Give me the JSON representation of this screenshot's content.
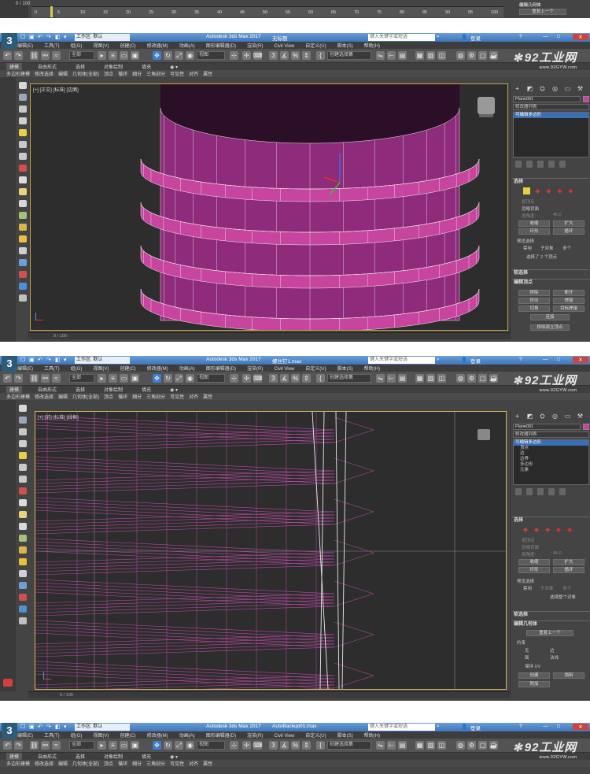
{
  "frame0": {
    "timeline_label": "0 / 100",
    "ticks": [
      "0",
      "5",
      "10",
      "15",
      "20",
      "25",
      "30",
      "35",
      "40",
      "45",
      "50",
      "55",
      "60",
      "65",
      "70",
      "75",
      "80",
      "85",
      "90",
      "95",
      "100"
    ],
    "panel_label1": "编辑几何体",
    "panel_label2": "重复上一个"
  },
  "window": {
    "title": "Autodesk 3ds Max 2017",
    "logo": "3",
    "logo_sub": "MAX",
    "workspace": "工作区: 默认",
    "search_placeholder": "键入关键字或短语",
    "login": "登录",
    "menus": [
      "编辑(E)",
      "工具(T)",
      "组(G)",
      "视图(V)",
      "创建(C)",
      "修改器(M)",
      "动画(A)",
      "图形编辑器(D)",
      "渲染(R)",
      "Civil View",
      "自定义(U)",
      "脚本(S)",
      "帮助(H)"
    ],
    "toolbar": {
      "filter": "全部",
      "view": "视图",
      "selset": "创建选择集"
    },
    "ribbon_tabs": [
      "建模",
      "自由形式",
      "选择",
      "对象绘制",
      "填充"
    ],
    "ribbon_sub": [
      "多边形建模",
      "修改选择",
      "编辑",
      "几何体(全部)",
      "顶点",
      "循环",
      "细分",
      "三角剖分",
      "可见性",
      "对齐",
      "属性"
    ]
  },
  "watermark": {
    "brand": "92工业网",
    "url": "www.92GYW.com"
  },
  "screens": [
    {
      "title_suffix": "无标题",
      "viewport_label": "[+] [正交] [标准] [边面]",
      "object_name": "Plane001",
      "modifier_list": "修改器列表",
      "stack": [
        "可编辑多边形"
      ],
      "rollout_select": "选择",
      "labels": {
        "by_vertex": "按顶点",
        "ignore_back": "忽略背面",
        "by_angle": "按角度:",
        "angle_val": "45.0",
        "shrink": "收缩",
        "grow": "扩大",
        "ring": "环形",
        "loop": "循环",
        "preview": "预览选择",
        "off": "禁用",
        "subobj": "子对象",
        "multi": "多个",
        "status": "选择了 2 个顶点"
      },
      "rollout_soft": "软选择",
      "rollout_edit": "编辑顶点",
      "edit_btns": [
        "移除",
        "断开",
        "挤出",
        "焊接",
        "切角",
        "目标焊接",
        "连接",
        "移除孤立顶点"
      ],
      "timeline": "0 / 100"
    },
    {
      "title_suffix": "螺丝钉1.max",
      "viewport_label": "[+] [前] [标准] [线框]",
      "object_name": "Plane001",
      "modifier_list": "修改器列表",
      "stack": [
        "可编辑多边形",
        "顶点",
        "边",
        "边界",
        "多边形",
        "元素"
      ],
      "rollout_select": "选择",
      "labels": {
        "by_vertex": "按顶点",
        "ignore_back": "忽略背面",
        "by_angle": "按角度:",
        "angle_val": "45.0",
        "shrink": "收缩",
        "grow": "扩大",
        "ring": "环形",
        "loop": "循环",
        "preview": "预览选择",
        "off": "禁用",
        "subobj": "子对象",
        "multi": "多个",
        "status": "选择整个对象"
      },
      "rollout_soft": "软选择",
      "rollout_geom": "编辑几何体",
      "repeat": "重复上一个",
      "constraint": "约束",
      "c_none": "无",
      "c_edge": "边",
      "c_face": "面",
      "c_normal": "法线",
      "keep_uv": "保持 UV",
      "create": "创建",
      "collapse": "塌陷",
      "attach": "附加",
      "timeline": "0 / 100"
    },
    {
      "title_suffix": "AutoBackup01.max"
    }
  ],
  "colors": {
    "accent": "#d63ca8",
    "wire": "#b84aa4",
    "sel_blue": "#3a6fb5"
  }
}
